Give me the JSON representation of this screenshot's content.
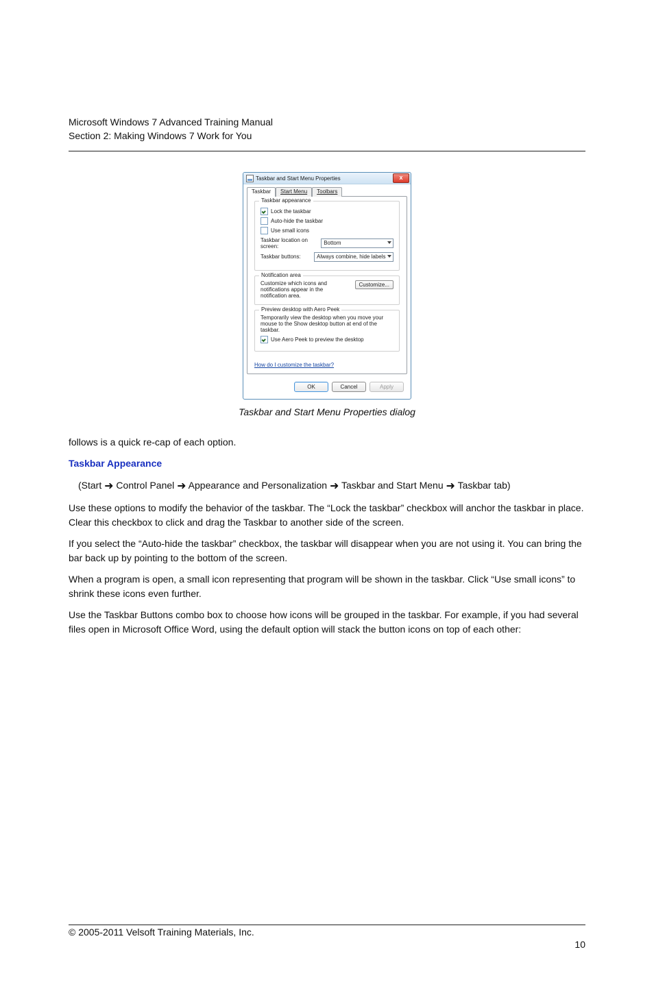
{
  "header": {
    "line1": "Microsoft Windows 7 Advanced Training Manual",
    "line2": "Section 2: Making Windows 7 Work for You"
  },
  "dialog": {
    "title": "Taskbar and Start Menu Properties",
    "tabs": [
      "Taskbar",
      "Start Menu",
      "Toolbars"
    ],
    "group_appearance": {
      "title": "Taskbar appearance",
      "cb_lock": "Lock the taskbar",
      "cb_autohide": "Auto-hide the taskbar",
      "cb_small": "Use small icons",
      "label_location": "Taskbar location on screen:",
      "val_location": "Bottom",
      "label_buttons": "Taskbar buttons:",
      "val_buttons": "Always combine, hide labels"
    },
    "group_notify": {
      "title": "Notification area",
      "text": "Customize which icons and notifications appear in the notification area.",
      "btn": "Customize..."
    },
    "group_peek": {
      "title": "Preview desktop with Aero Peek",
      "text": "Temporarily view the desktop when you move your mouse to the Show desktop button at end of the taskbar.",
      "cb_peek": "Use Aero Peek to preview the desktop"
    },
    "help": "How do I customize the taskbar?",
    "buttons": {
      "ok": "OK",
      "cancel": "Cancel",
      "apply": "Apply"
    }
  },
  "caption": "Taskbar and Start Menu Properties dialog",
  "body": {
    "para_intro": "follows is a quick re-cap of each option.",
    "pathA_title": "Taskbar Appearance",
    "para_path_prefix": "(Start ",
    "arrow": "➜",
    "para_path_tail": " Control Panel ",
    "para_path_tail2": " Appearance and Personalization ",
    "para_path_tail3": " Taskbar and Start Menu ",
    "para_path_tail4": " Taskbar tab)",
    "p1": "Use these options to modify the behavior of the taskbar. The “Lock the taskbar” checkbox will anchor the taskbar in place. Clear this checkbox to click and drag the Taskbar to another side of the screen.",
    "p2": "If you select the “Auto-hide the taskbar” checkbox, the taskbar will disappear when you are not using it. You can bring the bar back up by pointing to the bottom of the screen.",
    "p3": "When a program is open, a small icon representing that program will be shown in the taskbar. Click “Use small icons” to shrink these icons even further.",
    "p4": "Use the Taskbar Buttons combo box to choose how icons will be grouped in the taskbar. For example, if you had several files open in Microsoft Office Word, using the default option will stack the button icons on top of each other:"
  },
  "footer": {
    "copyright_left": "© 2005-2011 Velsoft Training Materials, Inc.",
    "pagenum": "10"
  }
}
